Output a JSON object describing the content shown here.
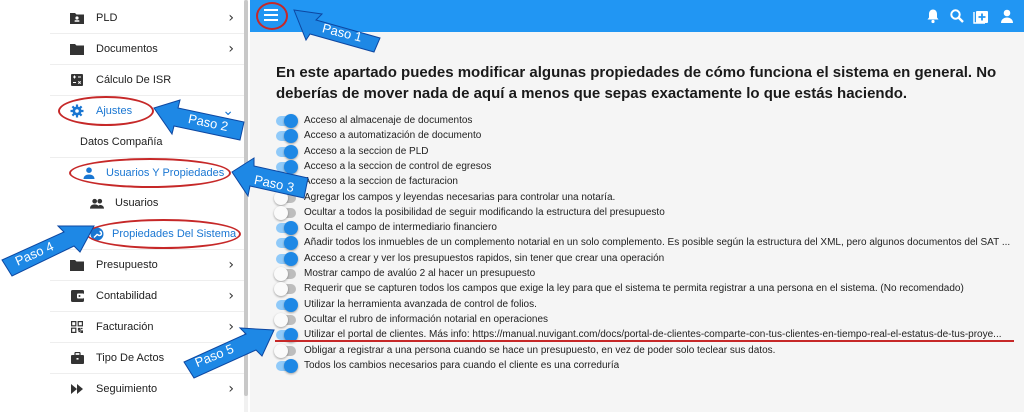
{
  "sidebar": {
    "items": [
      {
        "label": "PLD",
        "icon": "id-card-folder-icon"
      },
      {
        "label": "Documentos",
        "icon": "folder-icon"
      },
      {
        "label": "Cálculo De ISR",
        "icon": "calculator-icon"
      },
      {
        "label": "Ajustes",
        "icon": "gear-icon"
      },
      {
        "label": "Datos Compañía"
      },
      {
        "label": "Usuarios Y Propiedades",
        "icon": "person-icon"
      },
      {
        "label": "Usuarios",
        "icon": "people-icon"
      },
      {
        "label": "Propiedades Del Sistema",
        "icon": "wrench-icon"
      },
      {
        "label": "Presupuesto",
        "icon": "folder-icon"
      },
      {
        "label": "Contabilidad",
        "icon": "wallet-icon"
      },
      {
        "label": "Facturación",
        "icon": "qr-code-icon"
      },
      {
        "label": "Tipo De Actos",
        "icon": "briefcase-icon"
      },
      {
        "label": "Seguimiento",
        "icon": "fast-forward-icon"
      }
    ]
  },
  "appbar": {
    "menu_icon": "hamburger-menu-icon",
    "icons": [
      "bell-icon",
      "search-icon",
      "add-box-icon",
      "account-icon"
    ],
    "color": "#2196f3"
  },
  "main": {
    "heading": "En este apartado puedes modificar algunas propiedades de cómo funciona el sistema en general. No deberías de mover nada de aquí a menos que sepas exactamente lo que estás haciendo.",
    "options": [
      {
        "label": "Acceso al almacenaje de documentos",
        "on": true
      },
      {
        "label": "Acceso a automatización de documento",
        "on": true
      },
      {
        "label": "Acceso a la seccion de PLD",
        "on": true
      },
      {
        "label": "Acceso a la seccion de control de egresos",
        "on": true
      },
      {
        "label": "Acceso a la seccion de facturacion",
        "on": true
      },
      {
        "label": "Agregar los campos y leyendas necesarias para controlar una notaría.",
        "on": false
      },
      {
        "label": "Ocultar a todos la posibilidad de seguir modificando la estructura del presupuesto",
        "on": false
      },
      {
        "label": "Oculta el campo de intermediario financiero",
        "on": true
      },
      {
        "label": "Añadir todos los inmuebles de un complemento notarial en un solo complemento. Es posible según la estructura del XML, pero algunos documentos del SAT ...",
        "on": true
      },
      {
        "label": "Acceso a crear y ver los presupuestos rapidos, sin tener que crear una operación",
        "on": true
      },
      {
        "label": "Mostrar campo de avalúo 2 al hacer un presupuesto",
        "on": false
      },
      {
        "label": "Requerir que se capturen todos los campos que exige la ley para que el sistema te permita registrar a una persona en el sistema. (No recomendado)",
        "on": false
      },
      {
        "label": "Utilizar la herramienta avanzada de control de folios.",
        "on": true
      },
      {
        "label": "Ocultar el rubro de información notarial en operaciones",
        "on": false
      },
      {
        "label": "Utilizar el portal de clientes. Más info: https://manual.nuvigant.com/docs/portal-de-clientes-comparte-con-tus-clientes-en-tiempo-real-el-estatus-de-tus-proye...",
        "on": true
      },
      {
        "label": "Obligar a registrar a una persona cuando se hace un presupuesto, en vez de poder solo teclear sus datos.",
        "on": false
      },
      {
        "label": "Todos los cambios necesarios para cuando el cliente es una correduría",
        "on": true
      }
    ]
  },
  "annotations": {
    "steps": [
      "Paso 1",
      "Paso 2",
      "Paso 3",
      "Paso 4",
      "Paso 5"
    ],
    "arrow_color": "#1e88e5",
    "highlight_color": "#c62828"
  }
}
